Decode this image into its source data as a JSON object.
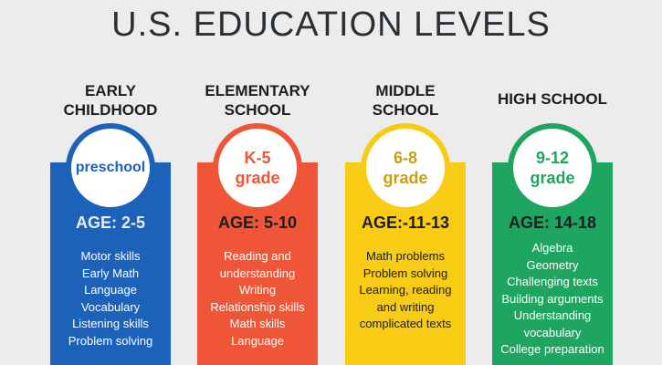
{
  "title": "U.S. EDUCATION LEVELS",
  "levels": [
    {
      "heading": [
        "EARLY",
        "CHILDHOOD"
      ],
      "badge": [
        "preschool"
      ],
      "age": "AGE: 2-5",
      "color": "#1b62b8",
      "skills": [
        "Motor skills",
        "Early Math",
        "Language",
        "Vocabulary",
        "Listening skills",
        "Problem solving"
      ]
    },
    {
      "heading": [
        "ELEMENTARY",
        "SCHOOL"
      ],
      "badge": [
        "K-5",
        "grade"
      ],
      "age": "AGE: 5-10",
      "color": "#ef5638",
      "skills": [
        "Reading and",
        "understanding",
        "Writing",
        "Relationship skills",
        "Math skills",
        "Language"
      ]
    },
    {
      "heading": [
        "MIDDLE",
        "SCHOOL"
      ],
      "badge": [
        "6-8",
        "grade"
      ],
      "age": "AGE:-11-13",
      "color": "#f8cb14",
      "skills": [
        "Math problems",
        "Problem solving",
        "Learning, reading",
        "and writing",
        "complicated texts"
      ]
    },
    {
      "heading": [
        "HIGH SCHOOL"
      ],
      "badge": [
        "9-12",
        "grade"
      ],
      "age": "AGE: 14-18",
      "color": "#1ea660",
      "skills": [
        "Algebra",
        "Geometry",
        "Challenging texts",
        "Building arguments",
        "Understanding",
        "vocabulary",
        "College preparation"
      ]
    }
  ]
}
